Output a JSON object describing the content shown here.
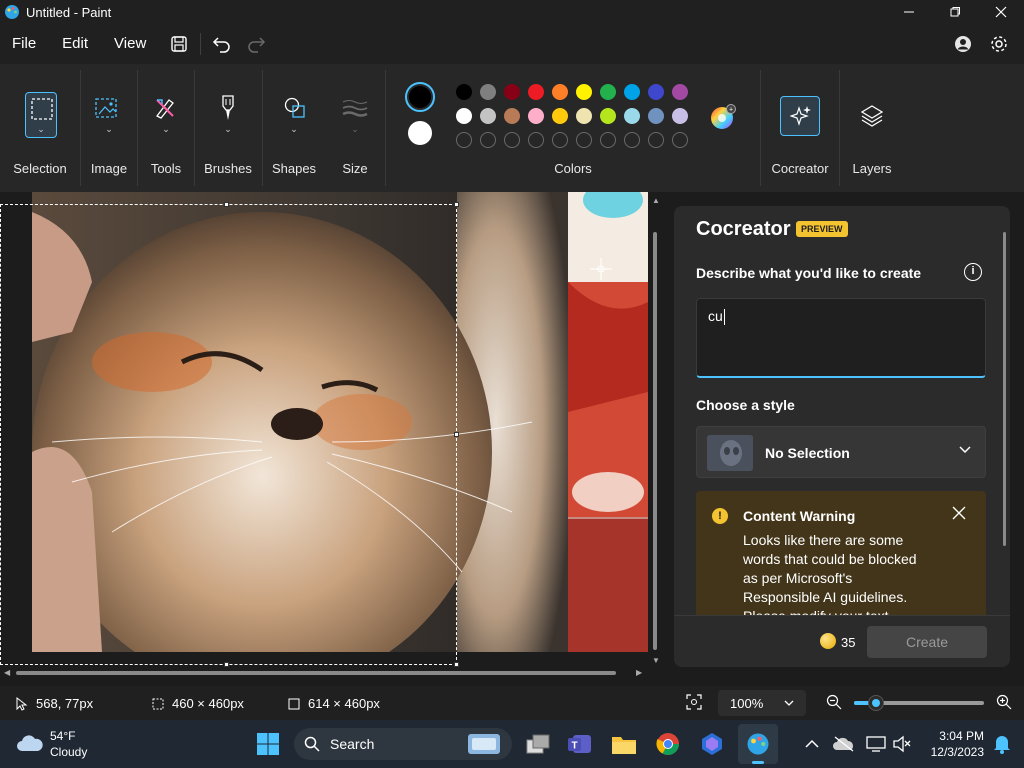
{
  "window": {
    "title": "Untitled - Paint",
    "icon": "paint-app-icon",
    "controls": [
      "minimize-icon",
      "maximize-icon",
      "close-icon"
    ]
  },
  "menu": {
    "file": "File",
    "edit": "Edit",
    "view": "View",
    "icons": [
      "save-icon",
      "undo-icon",
      "redo-icon",
      "account-icon",
      "settings-icon"
    ]
  },
  "ribbon": {
    "selection": "Selection",
    "image": "Image",
    "tools": "Tools",
    "brushes": "Brushes",
    "shapes": "Shapes",
    "size": "Size",
    "colors": "Colors",
    "cocreator": "Cocreator",
    "layers": "Layers",
    "color1": "#000000",
    "color2": "#ffffff",
    "palette_row1": [
      "#000000",
      "#7f7f7f",
      "#880015",
      "#ed1c24",
      "#ff7f27",
      "#fff200",
      "#22b14c",
      "#00a2e8",
      "#3f48cc",
      "#a349a4"
    ],
    "palette_row2": [
      "#ffffff",
      "#c3c3c3",
      "#b97a57",
      "#ffaec9",
      "#ffc90e",
      "#efe4b0",
      "#b5e61d",
      "#99d9ea",
      "#7092be",
      "#c8bfe7"
    ],
    "palette_row3_empty": 10
  },
  "panel": {
    "title": "Cocreator",
    "badge": "PREVIEW",
    "describe_label": "Describe what you'd like to create",
    "prompt_value": "cu",
    "style_label": "Choose a style",
    "style_value": "No Selection",
    "warning_title": "Content Warning",
    "warning_body": "Looks like there are some words that could be blocked as per Microsoft's Responsible AI guidelines. Please modify your text",
    "credits": "35",
    "create_button": "Create"
  },
  "status": {
    "cursor_pos": "568, 77px",
    "selection_size": "460 × 460px",
    "canvas_size": "614 × 460px",
    "zoom": "100%",
    "zoom_fraction": 0.17
  },
  "taskbar": {
    "weather_temp": "54°F",
    "weather_desc": "Cloudy",
    "search_placeholder": "Search",
    "time": "3:04 PM",
    "date": "12/3/2023"
  }
}
